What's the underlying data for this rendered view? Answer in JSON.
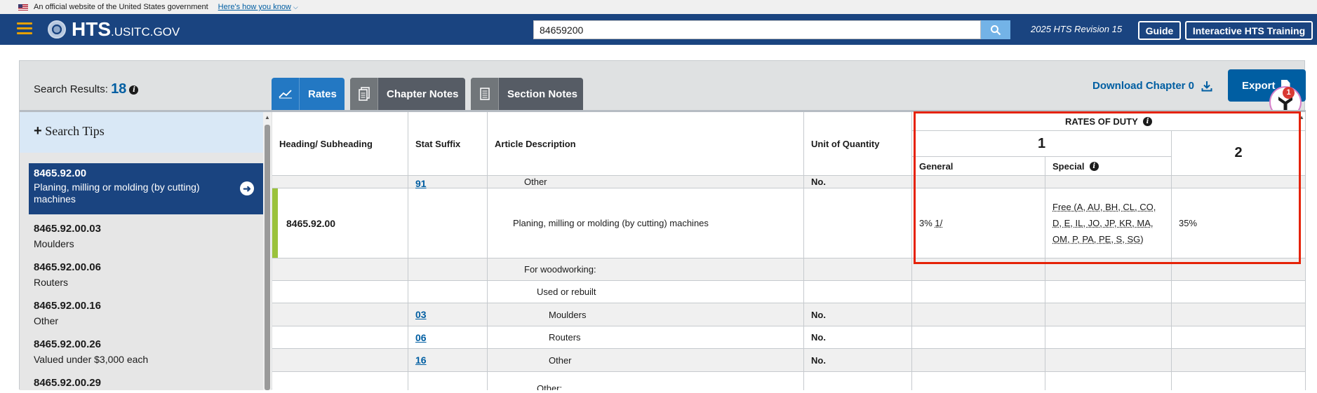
{
  "gov_banner": {
    "text": "An official website of the United States government",
    "link": "Here's how you know"
  },
  "header": {
    "brand": "HTS",
    "brand_suffix": ".USITC.GOV",
    "search_value": "84659200",
    "revision": "2025 HTS Revision 15",
    "guide_label": "Guide",
    "training_label": "Interactive HTS Training"
  },
  "toolbar": {
    "results_label": "Search Results:",
    "results_count": "18",
    "tabs": [
      {
        "label": "Rates"
      },
      {
        "label": "Chapter Notes"
      },
      {
        "label": "Section Notes"
      }
    ],
    "download_label": "Download Chapter 0",
    "export_label": "Export",
    "notification_count": "1"
  },
  "sidebar": {
    "tips_label": "Search Tips",
    "items": [
      {
        "code": "8465.92.00",
        "desc": "Planing, milling or molding (by cutting) machines"
      },
      {
        "code": "8465.92.00.03",
        "desc": "Moulders"
      },
      {
        "code": "8465.92.00.06",
        "desc": "Routers"
      },
      {
        "code": "8465.92.00.16",
        "desc": "Other"
      },
      {
        "code": "8465.92.00.26",
        "desc": "Valued under $3,000 each"
      },
      {
        "code": "8465.92.00.29",
        "desc": ""
      }
    ]
  },
  "table": {
    "headers": {
      "heading": "Heading/ Subheading",
      "stat": "Stat Suffix",
      "desc": "Article Description",
      "unit": "Unit of Quantity",
      "rates": "RATES OF DUTY",
      "col1": "1",
      "col2": "2",
      "general": "General",
      "special": "Special"
    },
    "rows": [
      {
        "heading": "",
        "stat": "91",
        "desc": "Other",
        "unit": "No.",
        "general": "",
        "special": "",
        "col2": ""
      },
      {
        "heading": "8465.92.00",
        "stat": "",
        "desc": "Planing, milling or molding (by cutting) machines",
        "unit": "",
        "general": "3%",
        "general_note": "1/",
        "special": "Free (A, AU, BH, CL, CO, D, E, IL, JO, JP, KR, MA, OM, P, PA, PE, S, SG)",
        "col2": "35%"
      },
      {
        "heading": "",
        "stat": "",
        "desc": "For woodworking:",
        "unit": "",
        "general": "",
        "special": "",
        "col2": ""
      },
      {
        "heading": "",
        "stat": "",
        "desc": "Used or rebuilt",
        "unit": "",
        "general": "",
        "special": "",
        "col2": ""
      },
      {
        "heading": "",
        "stat": "03",
        "desc": "Moulders",
        "unit": "No.",
        "general": "",
        "special": "",
        "col2": ""
      },
      {
        "heading": "",
        "stat": "06",
        "desc": "Routers",
        "unit": "No.",
        "general": "",
        "special": "",
        "col2": ""
      },
      {
        "heading": "",
        "stat": "16",
        "desc": "Other",
        "unit": "No.",
        "general": "",
        "special": "",
        "col2": ""
      },
      {
        "heading": "",
        "stat": "",
        "desc": "Other:",
        "unit": "",
        "general": "",
        "special": "",
        "col2": ""
      }
    ]
  },
  "colors": {
    "header_bg": "#1a4480",
    "accent": "#005ea2",
    "highlight": "#e52207",
    "row_marker": "#9bc23c"
  }
}
